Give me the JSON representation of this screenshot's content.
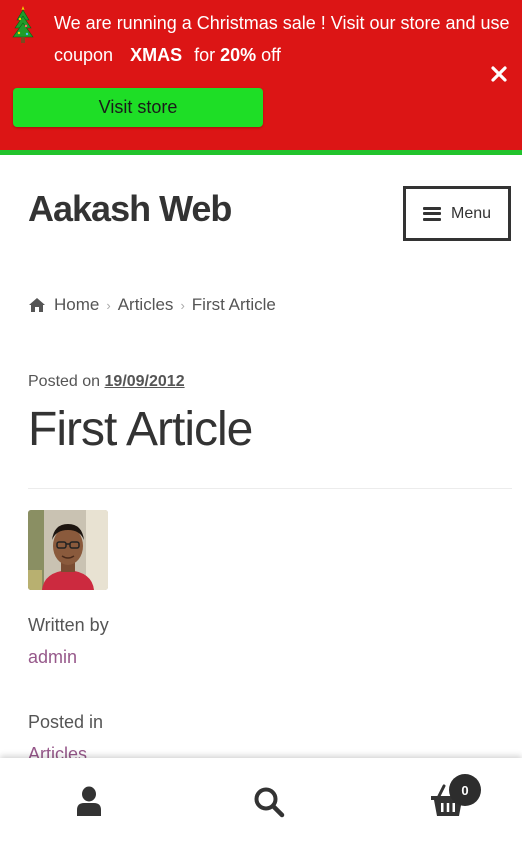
{
  "banner": {
    "text_before": "We are running a Christmas sale ! Visit our store and use coupon",
    "coupon": "XMAS",
    "text_middle": "for",
    "discount": "20%",
    "text_after": "off",
    "button_label": "Visit store",
    "bg_color": "#dc1515",
    "button_color": "#1ede26",
    "icons": {
      "tree": "christmas-tree-icon",
      "close": "close-icon"
    }
  },
  "header": {
    "site_title": "Aakash Web",
    "menu_label": "Menu"
  },
  "breadcrumb": {
    "items": [
      "Home",
      "Articles",
      "First Article"
    ]
  },
  "post": {
    "posted_on_label": "Posted on",
    "date": "19/09/2012",
    "title": "First Article",
    "written_by_label": "Written by",
    "author": "admin",
    "posted_in_label": "Posted in",
    "category": "Articles",
    "link_color": "#96588a"
  },
  "bottom_bar": {
    "icons": [
      "account-icon",
      "search-icon",
      "cart-icon"
    ],
    "cart_count": "0"
  }
}
